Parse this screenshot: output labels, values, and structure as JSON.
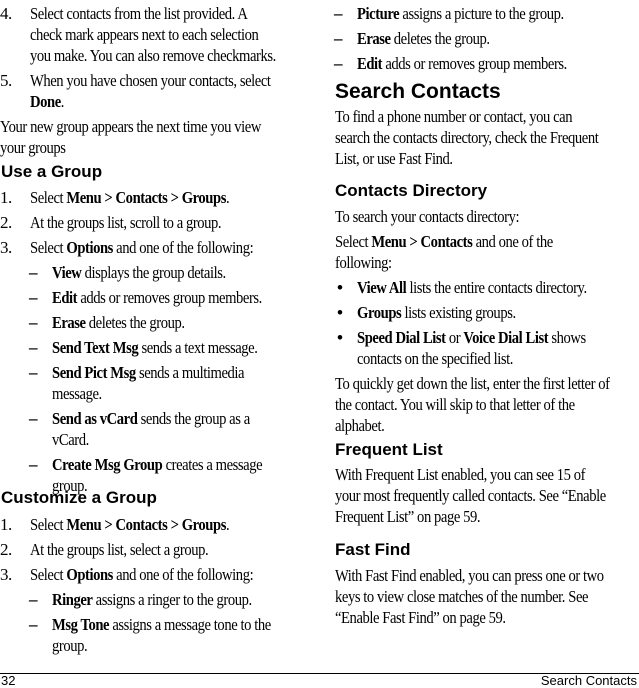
{
  "left_column": {
    "intro_steps": [
      {
        "num": "4.",
        "lines": [
          "Select contacts from the list provided. A",
          "check mark appears next to each selection",
          "you make. You can also remove checkmarks."
        ]
      },
      {
        "num": "5.",
        "line1": "When you have chosen your contacts, select",
        "bold": "Done",
        "after": "."
      }
    ],
    "intro_note_lines": [
      "Your new group appears the next time you view",
      "your groups"
    ],
    "use_group": {
      "heading": "Use a Group",
      "step1": {
        "num": "1.",
        "pre": "Select ",
        "bold": "Menu > Contacts > Groups",
        "post": "."
      },
      "step2": {
        "num": "2.",
        "text": "At the groups list, scroll to a group."
      },
      "step3": {
        "num": "3.",
        "pre": "Select ",
        "bold": "Options",
        "post": " and one of the following:"
      },
      "options": [
        {
          "bold": "View",
          "lines": [
            " displays the group details."
          ]
        },
        {
          "bold": "Edit",
          "lines": [
            " adds or removes group members."
          ]
        },
        {
          "bold": "Erase",
          "lines": [
            " deletes the group."
          ]
        },
        {
          "bold": "Send Text Msg",
          "lines": [
            " sends a text message."
          ]
        },
        {
          "bold": "Send Pict Msg",
          "lines": [
            " sends a multimedia",
            "message."
          ]
        },
        {
          "bold": "Send as vCard",
          "lines": [
            " sends the group as a",
            "vCard."
          ]
        },
        {
          "bold": "Create Msg Group",
          "lines": [
            " creates a message",
            "group."
          ]
        }
      ]
    },
    "customize_group": {
      "heading": "Customize a Group",
      "step1": {
        "num": "1.",
        "pre": "Select ",
        "bold": "Menu > Contacts > Groups",
        "post": "."
      },
      "step2": {
        "num": "2.",
        "text": "At the groups list, select a group."
      },
      "step3": {
        "num": "3.",
        "pre": "Select ",
        "bold": "Options",
        "post": " and one of the following:"
      },
      "options": [
        {
          "bold": "Ringer",
          "lines": [
            " assigns a ringer to the group."
          ]
        },
        {
          "bold": "Msg Tone",
          "lines": [
            " assigns a message tone to the",
            "group."
          ]
        }
      ]
    }
  },
  "right_column": {
    "continued_options": [
      {
        "bold": "Picture",
        "text": " assigns a picture to the group."
      },
      {
        "bold": "Erase",
        "text": " deletes the group."
      },
      {
        "bold": "Edit",
        "text": " adds or removes group members."
      }
    ],
    "search_contacts": {
      "heading": "Search Contacts",
      "lines": [
        "To find a phone number or contact, you can",
        "search the contacts directory, check the Frequent",
        "List, or use Fast Find."
      ]
    },
    "contacts_directory": {
      "heading": "Contacts Directory",
      "intro": "To search your contacts directory:",
      "select_pre": "Select ",
      "select_bold": "Menu > Contacts",
      "select_post": " and one of the",
      "select_line2": "following:",
      "bullets": [
        {
          "bold": "View All",
          "text": " lists the entire contacts directory."
        },
        {
          "bold": "Groups",
          "text": " lists existing groups."
        }
      ],
      "bullet3": {
        "bold1": "Speed Dial List",
        "mid": " or ",
        "bold2": "Voice Dial List",
        "post": " shows",
        "line2": "contacts on the specified list."
      },
      "tip_lines": [
        "To quickly get down the list, enter the first letter of",
        "the contact. You will skip to that letter of the",
        "alphabet."
      ]
    },
    "frequent_list": {
      "heading": "Frequent List",
      "lines": [
        "With Frequent List enabled, you can see 15 of",
        "your most frequently called contacts. See “Enable",
        "Frequent List” on page 59."
      ]
    },
    "fast_find": {
      "heading": "Fast Find",
      "lines": [
        "With Fast Find enabled, you can press one or two",
        "keys to view close matches of the number. See",
        "“Enable Fast Find” on page 59."
      ]
    }
  },
  "footer": {
    "page_number": "32",
    "section_title": "Search Contacts"
  },
  "glyphs": {
    "dash": "–",
    "bullet": "•"
  }
}
